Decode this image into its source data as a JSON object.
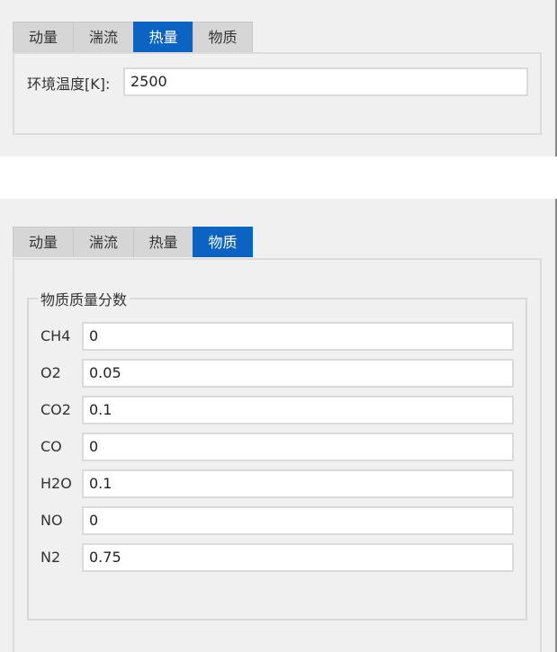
{
  "tabs": [
    "动量",
    "湍流",
    "热量",
    "物质"
  ],
  "top_panel": {
    "active_tab": "热量",
    "temperature_label": "环境温度[K]:",
    "temperature_value": "2500"
  },
  "bottom_panel": {
    "active_tab": "物质",
    "group_title": "物质质量分数",
    "species": [
      {
        "name": "CH4",
        "value": "0"
      },
      {
        "name": "O2",
        "value": "0.05"
      },
      {
        "name": "CO2",
        "value": "0.1"
      },
      {
        "name": "CO",
        "value": "0"
      },
      {
        "name": "H2O",
        "value": "0.1"
      },
      {
        "name": "NO",
        "value": "0"
      },
      {
        "name": "N2",
        "value": "0.75"
      }
    ]
  },
  "colors": {
    "active_tab": "#0d63c2",
    "inactive_tab": "#d6d6d6",
    "panel_bg": "#f0f0f0"
  }
}
